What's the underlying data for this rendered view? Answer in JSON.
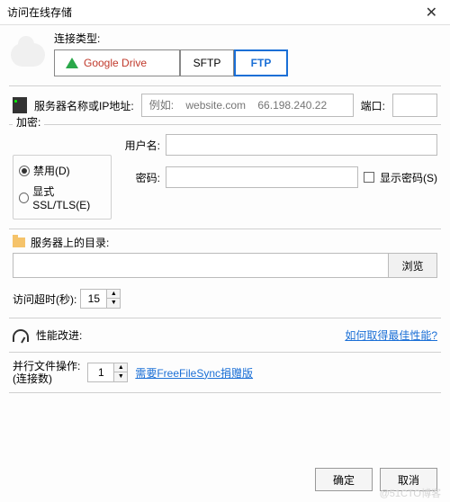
{
  "window": {
    "title": "访问在线存储"
  },
  "connection": {
    "type_label": "连接类型:",
    "tabs": {
      "google_drive": "Google Drive",
      "sftp": "SFTP",
      "ftp": "FTP"
    }
  },
  "server": {
    "label": "服务器名称或IP地址:",
    "placeholder": "例如:    website.com    66.198.240.22",
    "port_label": "端口:",
    "port_value": ""
  },
  "encryption": {
    "title": "加密:",
    "disabled": "禁用(D)",
    "ssl": "显式SSL/TLS(E)"
  },
  "credentials": {
    "user_label": "用户名:",
    "user_value": "",
    "pass_label": "密码:",
    "pass_value": "",
    "show_pass": "显示密码(S)"
  },
  "directory": {
    "label": "服务器上的目录:",
    "value": "",
    "browse": "浏览"
  },
  "timeout": {
    "label": "访问超时(秒):",
    "value": "15"
  },
  "performance": {
    "label": "性能改进:",
    "link": "如何取得最佳性能?"
  },
  "parallel": {
    "label1": "并行文件操作:",
    "label2": "(连接数)",
    "value": "1",
    "link": "需要FreeFileSync捐赠版"
  },
  "buttons": {
    "ok": "确定",
    "cancel": "取消"
  },
  "watermark": "@51CTO博客"
}
